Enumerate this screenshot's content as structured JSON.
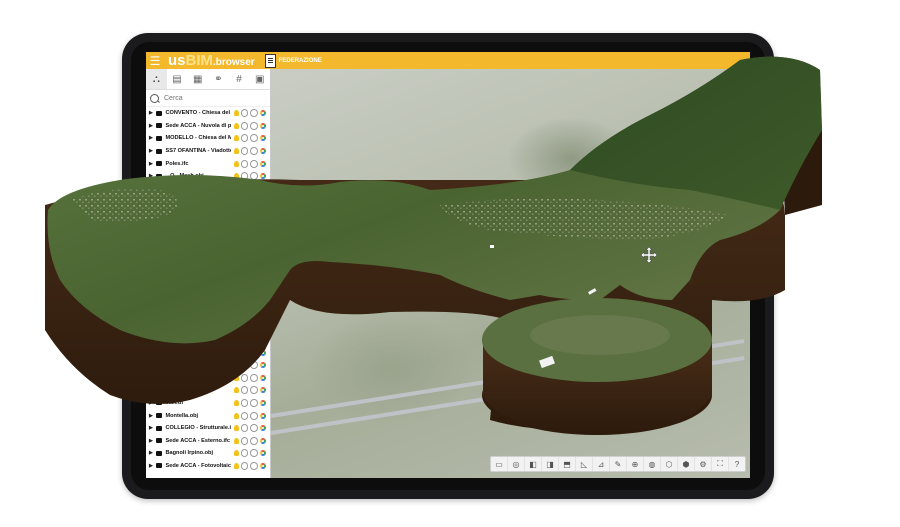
{
  "header": {
    "logo_prefix": "us",
    "logo_bim": "BIM",
    "logo_suffix": ".browser",
    "federation_label": "FEDERAZIONE"
  },
  "sidebar": {
    "tabs": [
      {
        "icon": "hierarchy-icon",
        "glyph": "⛬"
      },
      {
        "icon": "document-icon",
        "glyph": "▤"
      },
      {
        "icon": "properties-icon",
        "glyph": "▦"
      },
      {
        "icon": "link-icon",
        "glyph": "⚭"
      },
      {
        "icon": "hash-icon",
        "glyph": "#"
      },
      {
        "icon": "layers-icon",
        "glyph": "▣"
      }
    ],
    "search_placeholder": "Cerca",
    "items": [
      {
        "label": "CONVENTO - Chiesa del ..."
      },
      {
        "label": "Sede ACCA - Nuvola di pu..."
      },
      {
        "label": "MODELLO - Chiesa del M..."
      },
      {
        "label": "SS7 OFANTINA - Viadotto..."
      },
      {
        "label": "Poles.ifc"
      },
      {
        "label": "...O - Mesh.obj"
      },
      {
        "label": ""
      },
      {
        "label": ""
      },
      {
        "label": ""
      },
      {
        "label": ""
      },
      {
        "label": ""
      },
      {
        "label": ""
      },
      {
        "label": ""
      },
      {
        "label": ""
      },
      {
        "label": ""
      },
      {
        "label": ""
      },
      {
        "label": ""
      },
      {
        "label": ""
      },
      {
        "label": ""
      },
      {
        "label": ""
      },
      {
        "label": ""
      },
      {
        "label": ""
      },
      {
        "label": ""
      },
      {
        "label": "...a.edf"
      },
      {
        "label": "Montella.obj"
      },
      {
        "label": "COLLEGIO - Strutturale.ifc"
      },
      {
        "label": "Sede ACCA - Esterno.ifc"
      },
      {
        "label": "Bagnoli Irpino.obj"
      },
      {
        "label": "Sede ACCA - Fotovoltaico..."
      }
    ]
  },
  "toolbar": {
    "buttons": [
      {
        "name": "camera-icon",
        "glyph": "▭"
      },
      {
        "name": "orbit-icon",
        "glyph": "◎"
      },
      {
        "name": "cube-front-icon",
        "glyph": "◧"
      },
      {
        "name": "cube-side-icon",
        "glyph": "◨"
      },
      {
        "name": "cube-top-icon",
        "glyph": "⬒"
      },
      {
        "name": "measure-icon",
        "glyph": "◺"
      },
      {
        "name": "section-icon",
        "glyph": "⊿"
      },
      {
        "name": "pencil-icon",
        "glyph": "✎"
      },
      {
        "name": "target-icon",
        "glyph": "⊕"
      },
      {
        "name": "globe-icon",
        "glyph": "◍"
      },
      {
        "name": "box-icon",
        "glyph": "⬡"
      },
      {
        "name": "box-3d-icon",
        "glyph": "⬢"
      },
      {
        "name": "settings-icon",
        "glyph": "⚙"
      },
      {
        "name": "fullscreen-icon",
        "glyph": "⛶"
      },
      {
        "name": "help-icon",
        "glyph": "?"
      }
    ]
  },
  "colors": {
    "accent": "#f3b82b",
    "soil": "#3b2414",
    "terrain_green": "#4d6b34"
  }
}
